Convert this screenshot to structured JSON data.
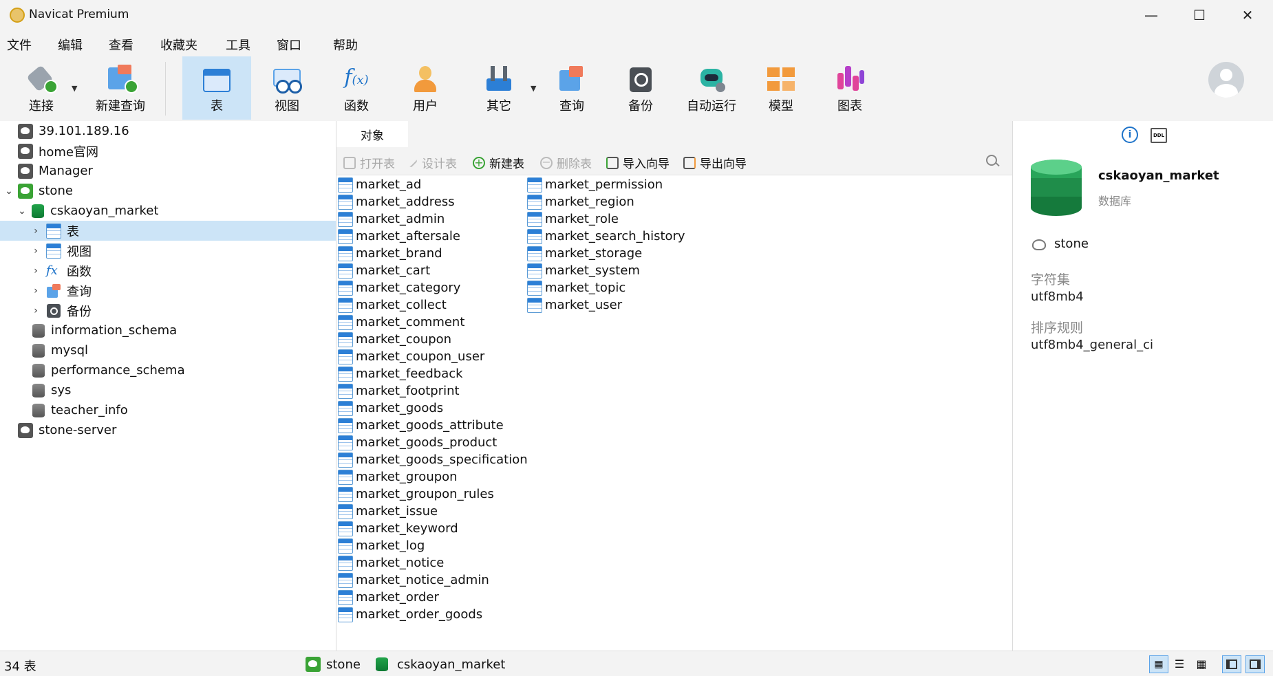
{
  "window": {
    "title": "Navicat Premium"
  },
  "menu": [
    "文件",
    "编辑",
    "查看",
    "收藏夹",
    "工具",
    "窗口",
    "帮助"
  ],
  "toolbar": {
    "connect": "连接",
    "new_query": "新建查询",
    "table": "表",
    "view": "视图",
    "function": "函数",
    "user": "用户",
    "other": "其它",
    "query": "查询",
    "backup": "备份",
    "auto_run": "自动运行",
    "model": "模型",
    "chart": "图表"
  },
  "tree": {
    "conn1": "39.101.189.16",
    "conn2": "home官网",
    "conn3": "Manager",
    "conn4": "stone",
    "db_active": "cskaoyan_market",
    "node_table": "表",
    "node_view": "视图",
    "node_function": "函数",
    "node_query": "查询",
    "node_backup": "备份",
    "db2": "information_schema",
    "db3": "mysql",
    "db4": "performance_schema",
    "db5": "sys",
    "db6": "teacher_info",
    "conn5": "stone-server"
  },
  "tabs": {
    "objects": "对象"
  },
  "objtoolbar": {
    "open": "打开表",
    "design": "设计表",
    "new": "新建表",
    "delete": "删除表",
    "import": "导入向导",
    "export": "导出向导"
  },
  "tables": [
    "market_ad",
    "market_address",
    "market_admin",
    "market_aftersale",
    "market_brand",
    "market_cart",
    "market_category",
    "market_collect",
    "market_comment",
    "market_coupon",
    "market_coupon_user",
    "market_feedback",
    "market_footprint",
    "market_goods",
    "market_goods_attribute",
    "market_goods_product",
    "market_goods_specification",
    "market_groupon",
    "market_groupon_rules",
    "market_issue",
    "market_keyword",
    "market_log",
    "market_notice",
    "market_notice_admin",
    "market_order",
    "market_order_goods",
    "market_permission",
    "market_region",
    "market_role",
    "market_search_history",
    "market_storage",
    "market_system",
    "market_topic",
    "market_user"
  ],
  "info": {
    "name": "cskaoyan_market",
    "type": "数据库",
    "connection": "stone",
    "charset_label": "字符集",
    "charset": "utf8mb4",
    "collation_label": "排序规则",
    "collation": "utf8mb4_general_ci"
  },
  "status": {
    "count": "34 表",
    "connection": "stone",
    "database": "cskaoyan_market"
  },
  "colors": {
    "accent": "#cce4f7",
    "db_green": "#22a34a",
    "table_blue": "#2c7fd6"
  }
}
